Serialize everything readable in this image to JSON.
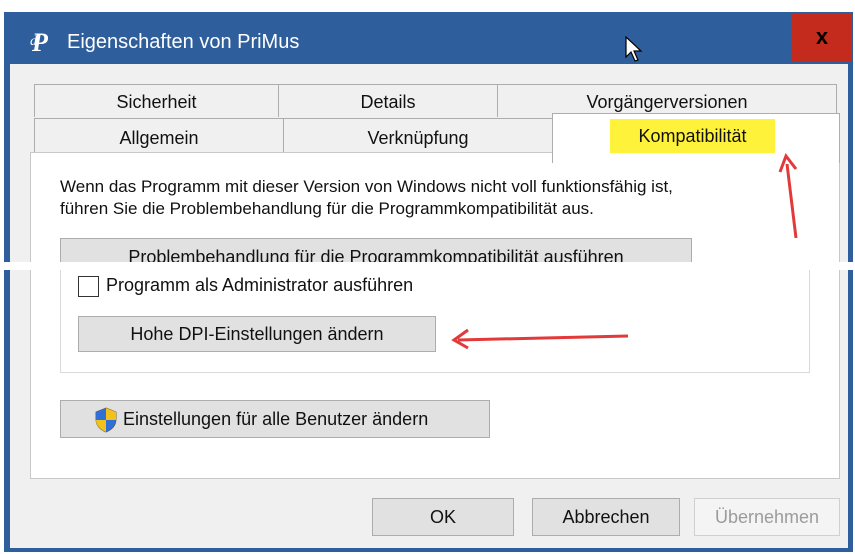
{
  "window": {
    "title": "Eigenschaften von PriMus",
    "close_label": "x"
  },
  "tabs": {
    "row1": [
      "Sicherheit",
      "Details",
      "Vorgängerversionen"
    ],
    "row2": [
      "Allgemein",
      "Verknüpfung",
      "Kompatibilität"
    ],
    "active": "Kompatibilität"
  },
  "compatibility": {
    "description_line1": "Wenn das Programm mit dieser Version von Windows nicht voll funktionsfähig ist,",
    "description_line2": "führen Sie die Problembehandlung für die Programmkompatibilität aus.",
    "troubleshoot_button": "Problembehandlung für die Programmkompatibilität ausführen",
    "admin_checkbox_label": "Programm als Administrator ausführen",
    "admin_checked": false,
    "dpi_button": "Hohe DPI-Einstellungen ändern",
    "all_users_button": "Einstellungen für alle Benutzer ändern"
  },
  "footer": {
    "ok": "OK",
    "cancel": "Abbrechen",
    "apply": "Übernehmen"
  },
  "colors": {
    "titlebar": "#2f5e9c",
    "close": "#c42b1c",
    "highlight": "#fff23a",
    "annotation_arrow": "#e23a3a"
  },
  "icons": {
    "app": "primus-logo-icon",
    "shield": "uac-shield-icon",
    "cursor": "mouse-pointer-icon"
  }
}
